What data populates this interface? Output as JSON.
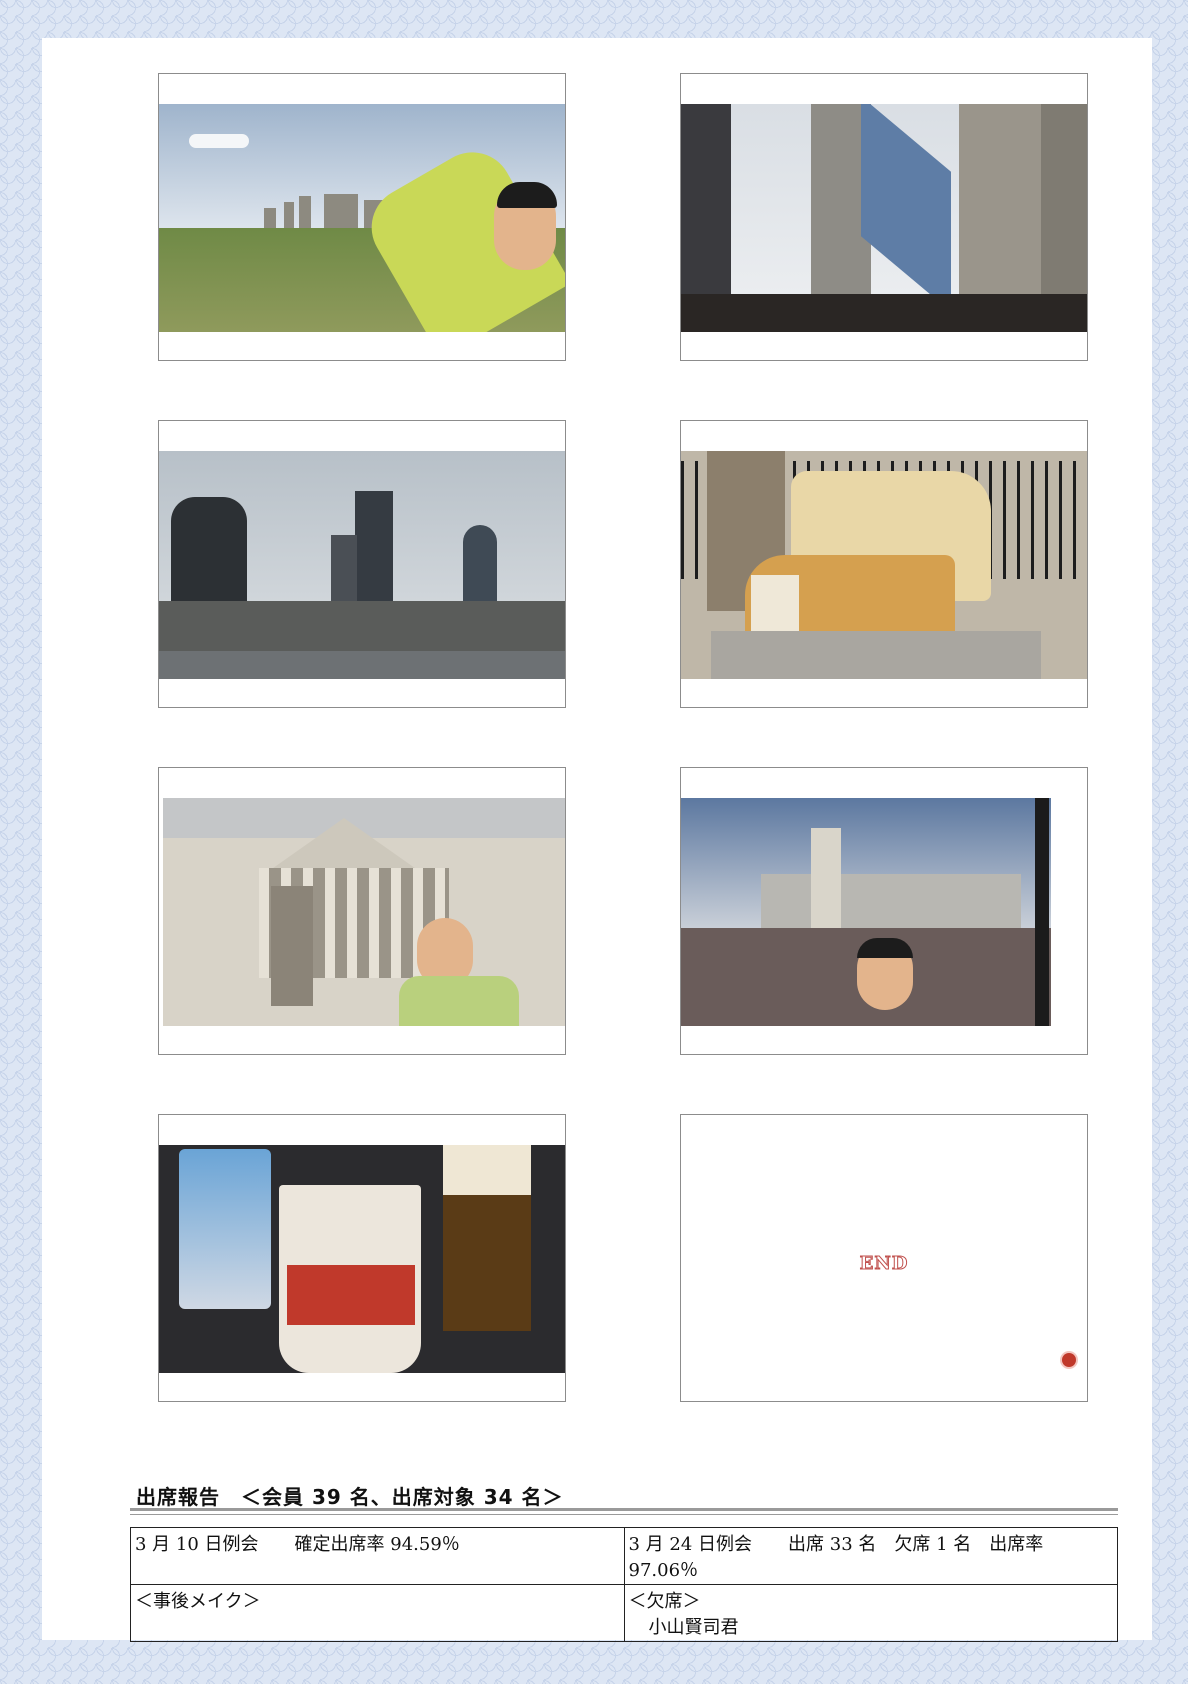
{
  "end_card": {
    "label": "END"
  },
  "attendance": {
    "title": "出席報告　＜会員 39 名、出席対象 34 名＞",
    "meeting_left": {
      "date": "3 月 10 日例会",
      "stat": "確定出席率 94.59％",
      "section_label": "＜事後メイク＞"
    },
    "meeting_right": {
      "date": "3 月 24 日例会",
      "stat": "出席 33 名　欠席 1 名　出席率 97.06％",
      "section_label": "＜欠席＞",
      "names": [
        "小山賢司君"
      ]
    }
  },
  "colors": {
    "border_pattern": "#c7d4ea",
    "end_dot": "#c0392b"
  }
}
